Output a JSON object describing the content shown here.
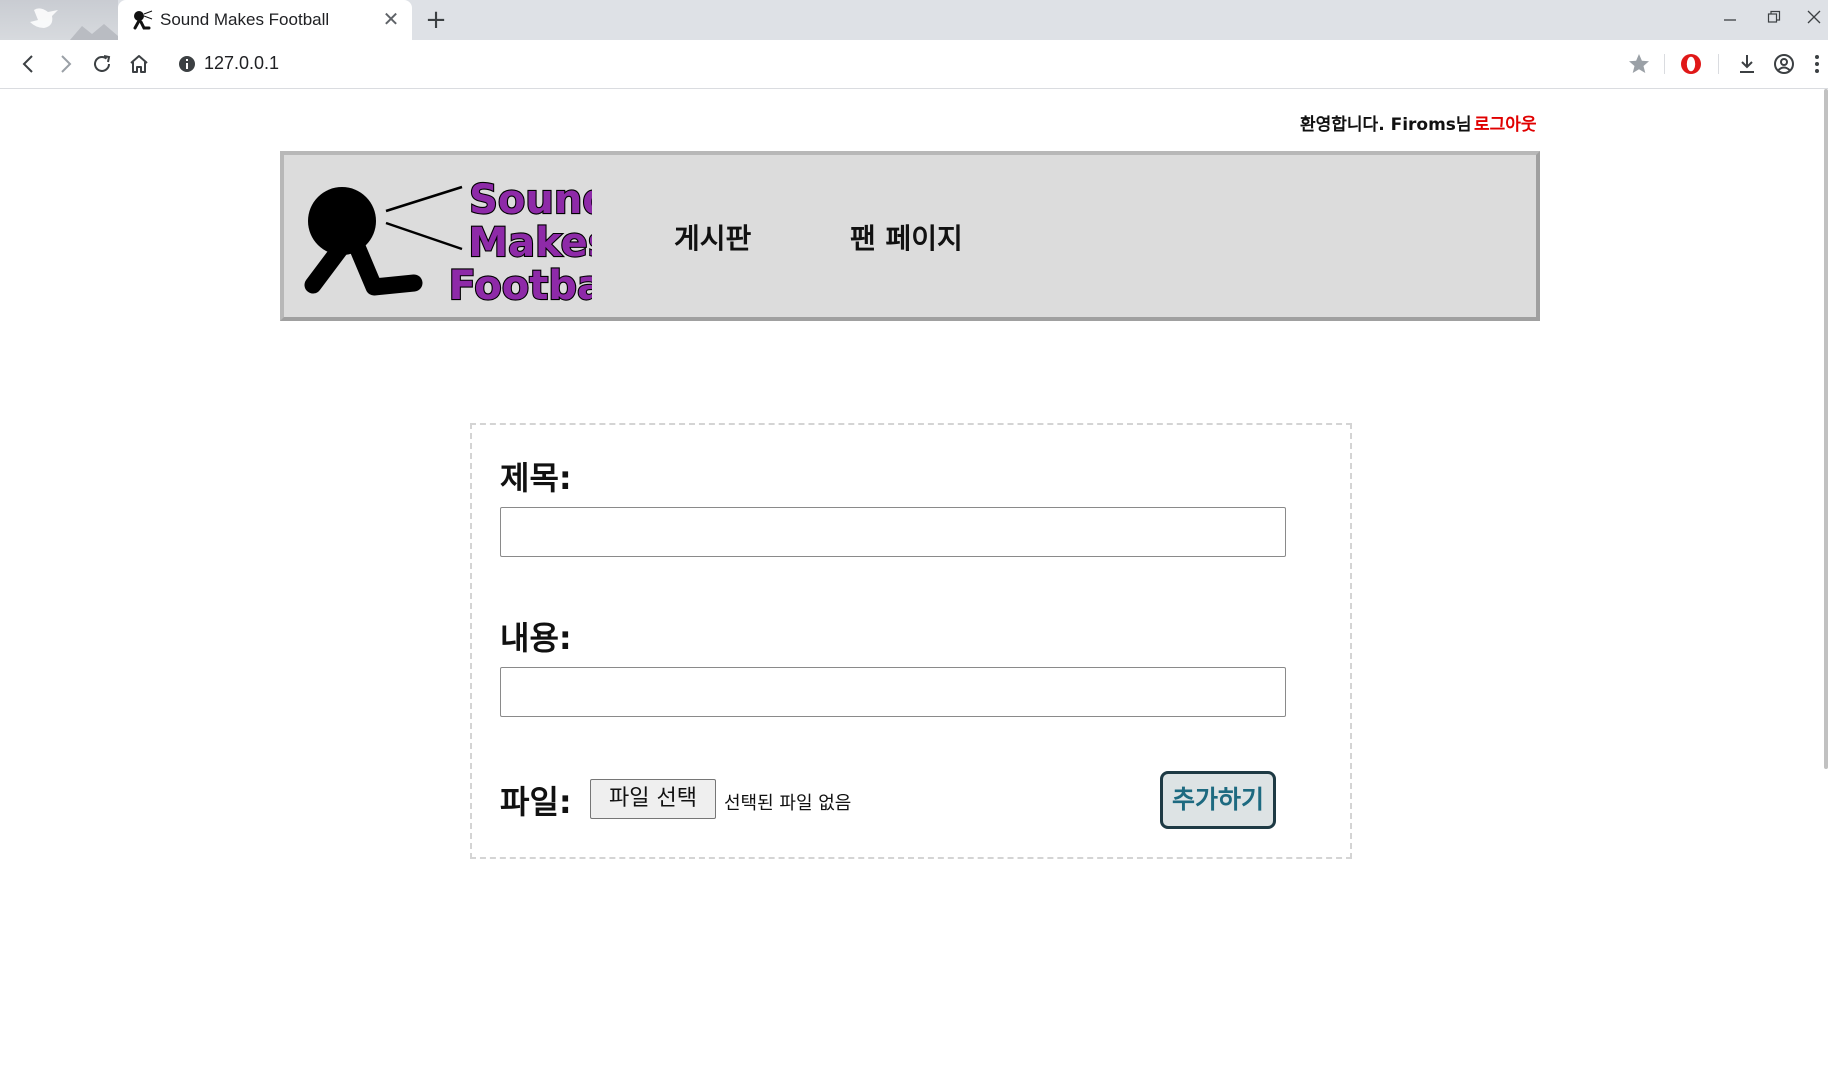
{
  "browser": {
    "tab_title": "Sound Makes Football",
    "tab_close": "✕",
    "new_tab": "+",
    "url": "127.0.0.1"
  },
  "page": {
    "welcome": "환영합니다. Firoms님",
    "logout": "로그아웃",
    "logo": {
      "line1": "Sound",
      "line2": "Makes",
      "line3": "Football",
      "text_color": "#8e2aa8"
    },
    "nav": [
      "게시판",
      "팬 페이지"
    ]
  },
  "form": {
    "title_label": "제목:",
    "title_value": "",
    "content_label": "내용:",
    "content_value": "",
    "file_label": "파일:",
    "file_button": "파일 선택",
    "file_status": "선택된 파일 없음",
    "submit": "추가하기"
  }
}
